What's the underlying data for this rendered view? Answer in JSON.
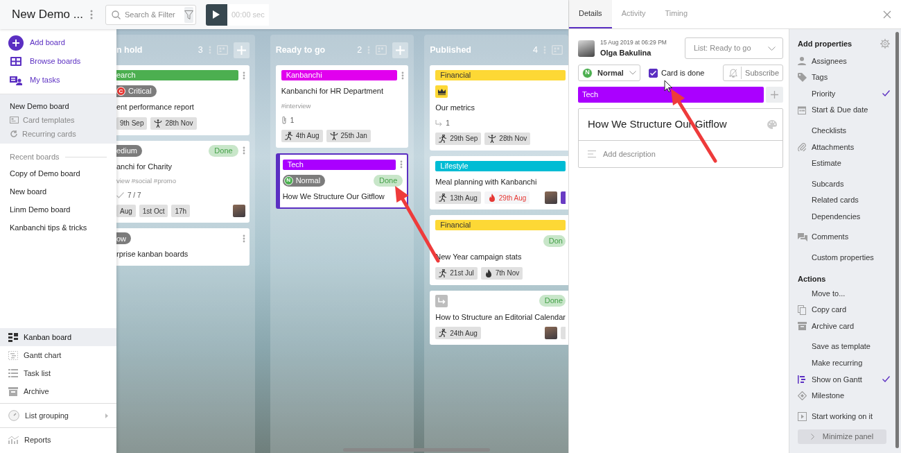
{
  "header": {
    "board_title": "New Demo ...",
    "search": {
      "placeholder": "Search & Filter"
    },
    "timer": "00:00 sec"
  },
  "sidebar": {
    "actions": [
      {
        "label": "Add board",
        "kind": "add"
      },
      {
        "label": "Browse boards",
        "kind": "browse"
      },
      {
        "label": "My tasks",
        "kind": "tasks"
      }
    ],
    "current_board": {
      "label": "New Demo board",
      "items": [
        {
          "label": "Card templates",
          "kind": "template"
        },
        {
          "label": "Recurring cards",
          "kind": "recurring"
        }
      ]
    },
    "recent_title": "Recent boards",
    "recent_boards": [
      "Copy of Demo board",
      "New board",
      "Linm Demo board",
      "Kanbanchi tips & tricks"
    ],
    "views": [
      {
        "label": "Kanban board",
        "kind": "kanban",
        "selected": true
      },
      {
        "label": "Gantt chart",
        "kind": "gantt",
        "selected": false
      },
      {
        "label": "Task list",
        "kind": "list",
        "selected": false
      },
      {
        "label": "Archive",
        "kind": "archive",
        "selected": false
      }
    ],
    "list_grouping": "List grouping",
    "reports": "Reports"
  },
  "columns": [
    {
      "title": "n hold",
      "count": "3",
      "add_button": true,
      "cards": [
        {
          "selected": false,
          "kebab": true,
          "tag": {
            "label": "earch",
            "color": "#4caf50"
          },
          "priority": {
            "letter": "C",
            "label": "Critical",
            "color": "#e53935"
          },
          "title": "ent performance report",
          "dates": [
            {
              "kind": "plain",
              "label": "9th Sep"
            },
            {
              "kind": "due",
              "label": "28th Nov"
            }
          ]
        },
        {
          "selected": false,
          "kebab": true,
          "priority": {
            "label": "edium"
          },
          "status": "Done",
          "title": "anchi for Charity",
          "hashtags": "view #social #promo",
          "checklist": "7 / 7",
          "dates": [
            {
              "kind": "plain",
              "label": "Aug"
            },
            {
              "kind": "plain",
              "label": "1st Oct"
            },
            {
              "kind": "plain",
              "label": "17h"
            }
          ],
          "avatar": true
        },
        {
          "selected": false,
          "kebab": true,
          "priority": {
            "label": "ow"
          },
          "title": "rprise kanban boards"
        }
      ]
    },
    {
      "title": "Ready to go",
      "count": "2",
      "add_button": true,
      "cards": [
        {
          "selected": false,
          "kebab": true,
          "tag": {
            "label": "Kanbanchi",
            "color": "#e100ee"
          },
          "title": "Kanbanchi for HR Department",
          "hashtags": "#interview",
          "attachments": "1",
          "dates": [
            {
              "kind": "start",
              "label": "4th Aug"
            },
            {
              "kind": "due",
              "label": "25th Jan"
            }
          ]
        },
        {
          "selected": true,
          "kebab": true,
          "tag": {
            "label": "Tech",
            "color": "#aa00ff"
          },
          "priority": {
            "letter": "N",
            "label": "Normal",
            "color": "#4caf50"
          },
          "status": "Done",
          "title": "How We Structure Our Gitflow"
        }
      ]
    },
    {
      "title": "Published",
      "count": "4",
      "cards": [
        {
          "selected": false,
          "tag": {
            "label": "Financial",
            "color": "#fdd835"
          },
          "badge": {
            "kind": "crown"
          },
          "title": "Our metrics",
          "subcards": "1",
          "dates": [
            {
              "kind": "start",
              "label": "29th Sep"
            },
            {
              "kind": "due",
              "label": "28th Nov"
            }
          ]
        },
        {
          "selected": false,
          "tag": {
            "label": "Lifestyle",
            "color": "#00bcd4"
          },
          "title": "Meal planning with Kanbanchi",
          "dates": [
            {
              "kind": "start",
              "label": "13th Aug"
            },
            {
              "kind": "overdue",
              "label": "29th Aug"
            }
          ],
          "avatar": true,
          "extra_member": {
            "color": "#6a3cc4"
          }
        },
        {
          "selected": false,
          "tag": {
            "label": "Financial",
            "color": "#fdd835"
          },
          "status": "Don",
          "title": "New Year campaign stats",
          "dates": [
            {
              "kind": "start",
              "label": "21st Jul"
            },
            {
              "kind": "fire",
              "label": "7th Nov"
            }
          ]
        },
        {
          "selected": false,
          "badge": {
            "kind": "subcard"
          },
          "status": "Done",
          "title": "How to Structure an Editorial Calendar",
          "dates": [
            {
              "kind": "start",
              "label": "24th Aug"
            }
          ],
          "avatar": true,
          "extra_member": {
            "color": "#e0e0e0"
          }
        }
      ]
    }
  ],
  "details": {
    "tabs": [
      {
        "label": "Details",
        "selected": true
      },
      {
        "label": "Activity",
        "selected": false
      },
      {
        "label": "Timing",
        "selected": false
      }
    ],
    "created": "15 Aug 2019 at 06:29 PM",
    "author": "Olga Bakulina",
    "list_select": "List: Ready to go",
    "priority": {
      "letter": "N",
      "label": "Normal",
      "color": "#4caf50"
    },
    "done_checkbox": {
      "label": "Card is done",
      "checked": true
    },
    "subscribe": "Subscribe",
    "tag": {
      "label": "Tech",
      "color": "#aa00ff"
    },
    "title": "How We Structure Our Gitflow",
    "description": {
      "placeholder": "Add description"
    }
  },
  "properties": {
    "title": "Add properties",
    "groups": [
      [
        {
          "label": "Assignees",
          "kind": "person",
          "checked": false
        },
        {
          "label": "Tags",
          "kind": "tag",
          "checked": false
        },
        {
          "label": "Priority",
          "kind": "plain",
          "checked": true
        },
        {
          "label": "Start & Due date",
          "kind": "calendar",
          "checked": false
        }
      ],
      [
        {
          "label": "Checklists",
          "kind": "plain",
          "checked": false
        },
        {
          "label": "Attachments",
          "kind": "clip",
          "checked": false
        },
        {
          "label": "Estimate",
          "kind": "plain",
          "checked": false
        }
      ],
      [
        {
          "label": "Subcards",
          "kind": "plain",
          "checked": false
        },
        {
          "label": "Related cards",
          "kind": "plain",
          "checked": false
        },
        {
          "label": "Dependencies",
          "kind": "plain",
          "checked": false
        }
      ],
      [
        {
          "label": "Comments",
          "kind": "chat",
          "checked": false
        }
      ],
      [
        {
          "label": "Custom properties",
          "kind": "plain",
          "checked": false
        }
      ]
    ],
    "actions_title": "Actions",
    "actions": [
      [
        {
          "label": "Move to...",
          "kind": "plain",
          "checked": false
        },
        {
          "label": "Copy card",
          "kind": "copy",
          "checked": false
        },
        {
          "label": "Archive card",
          "kind": "archive",
          "checked": false
        }
      ],
      [
        {
          "label": "Save as template",
          "kind": "plain",
          "checked": false
        },
        {
          "label": "Make recurring",
          "kind": "plain",
          "checked": false
        },
        {
          "label": "Show on Gantt",
          "kind": "gantt",
          "checked": true
        },
        {
          "label": "Milestone",
          "kind": "diamond",
          "checked": false
        }
      ],
      [
        {
          "label": "Start working on it",
          "kind": "play",
          "checked": false
        }
      ]
    ],
    "minimize": "Minimize panel"
  }
}
